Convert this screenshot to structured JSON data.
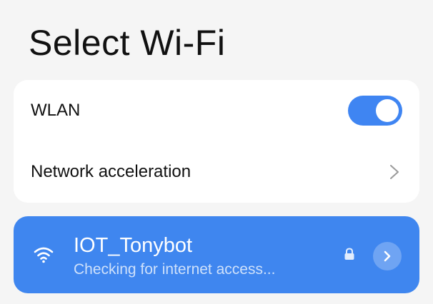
{
  "header": {
    "title": "Select Wi-Fi"
  },
  "settings": {
    "wlan": {
      "label": "WLAN",
      "enabled": true
    },
    "network_acceleration": {
      "label": "Network acceleration"
    }
  },
  "connected_network": {
    "name": "IOT_Tonybot",
    "status": "Checking for internet access...",
    "secured": true,
    "icons": {
      "signal": "wifi-icon",
      "security": "lock-icon",
      "detail": "chevron-right-icon"
    }
  },
  "colors": {
    "accent": "#3f85f2",
    "card": "#ffffff",
    "background": "#f5f5f5"
  }
}
